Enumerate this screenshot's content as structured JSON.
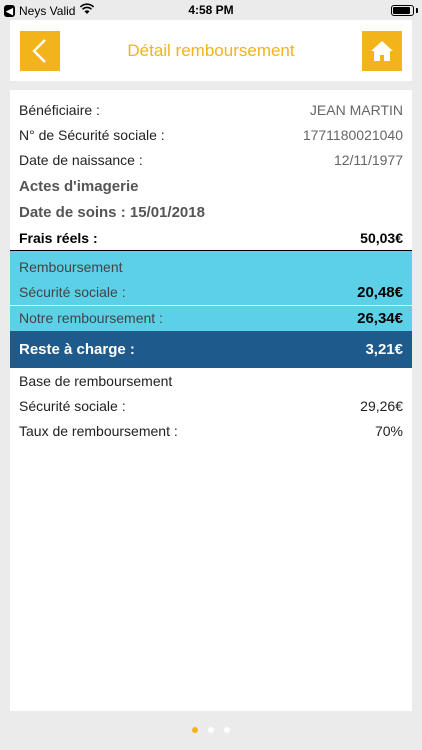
{
  "status": {
    "back_glyph": "◀",
    "carrier": "Neys Valid",
    "time": "4:58 PM",
    "battery_level": 0.9
  },
  "header": {
    "title": "Détail remboursement",
    "accent_color": "#f2b31b"
  },
  "details": {
    "beneficiaire_label": "Bénéficiaire :",
    "beneficiaire_value": "JEAN MARTIN",
    "secu_label": "N° de Sécurité sociale :",
    "secu_value": "1771180021040",
    "naissance_label": "Date de naissance :",
    "naissance_value": "12/11/1977",
    "acte": "Actes d'imagerie",
    "date_soins": "Date de soins : 15/01/2018",
    "frais_label": "Frais réels :",
    "frais_value": "50,03€"
  },
  "remboursement": {
    "title": "Remboursement",
    "secu_label": "Sécurité sociale :",
    "secu_value": "20,48€",
    "notre_label": "Notre remboursement :",
    "notre_value": "26,34€",
    "block_color": "#5bd0e6"
  },
  "reste": {
    "label": "Reste à charge :",
    "value": "3,21€",
    "block_color": "#1f5a8c"
  },
  "base": {
    "title": "Base de remboursement",
    "secu_label": "Sécurité sociale :",
    "secu_value": "29,26€",
    "taux_label": "Taux de remboursement :",
    "taux_value": "70%"
  },
  "pagination": {
    "count": 3,
    "active_index": 0
  }
}
